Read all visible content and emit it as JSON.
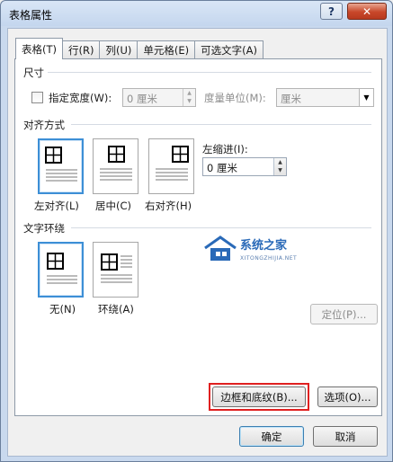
{
  "window": {
    "title": "表格属性",
    "help_label": "?",
    "close_label": "✕"
  },
  "tabs": [
    {
      "label": "表格(T)",
      "active": true
    },
    {
      "label": "行(R)",
      "active": false
    },
    {
      "label": "列(U)",
      "active": false
    },
    {
      "label": "单元格(E)",
      "active": false
    },
    {
      "label": "可选文字(A)",
      "active": false
    }
  ],
  "size": {
    "group_label": "尺寸",
    "specify_width_label": "指定宽度(W):",
    "specify_width_checked": false,
    "width_value": "0 厘米",
    "measure_in_label": "度量单位(M):",
    "measure_in_value": "厘米"
  },
  "alignment": {
    "group_label": "对齐方式",
    "options": [
      {
        "label": "左对齐(L)",
        "selected": true
      },
      {
        "label": "居中(C)",
        "selected": false
      },
      {
        "label": "右对齐(H)",
        "selected": false
      }
    ],
    "indent_label": "左缩进(I):",
    "indent_value": "0 厘米"
  },
  "text_wrapping": {
    "group_label": "文字环绕",
    "options": [
      {
        "label": "无(N)",
        "selected": true
      },
      {
        "label": "环绕(A)",
        "selected": false
      }
    ],
    "positioning_label": "定位(P)..."
  },
  "buttons": {
    "borders_shading": "边框和底纹(B)...",
    "options": "选项(O)...",
    "ok": "确定",
    "cancel": "取消"
  },
  "watermark": {
    "text": "系统之家",
    "sub": "XITONGZHIJIA.NET"
  },
  "colors": {
    "selection_border": "#3d8fd6",
    "highlight_box": "#e02020",
    "close_button": "#c8472a"
  }
}
